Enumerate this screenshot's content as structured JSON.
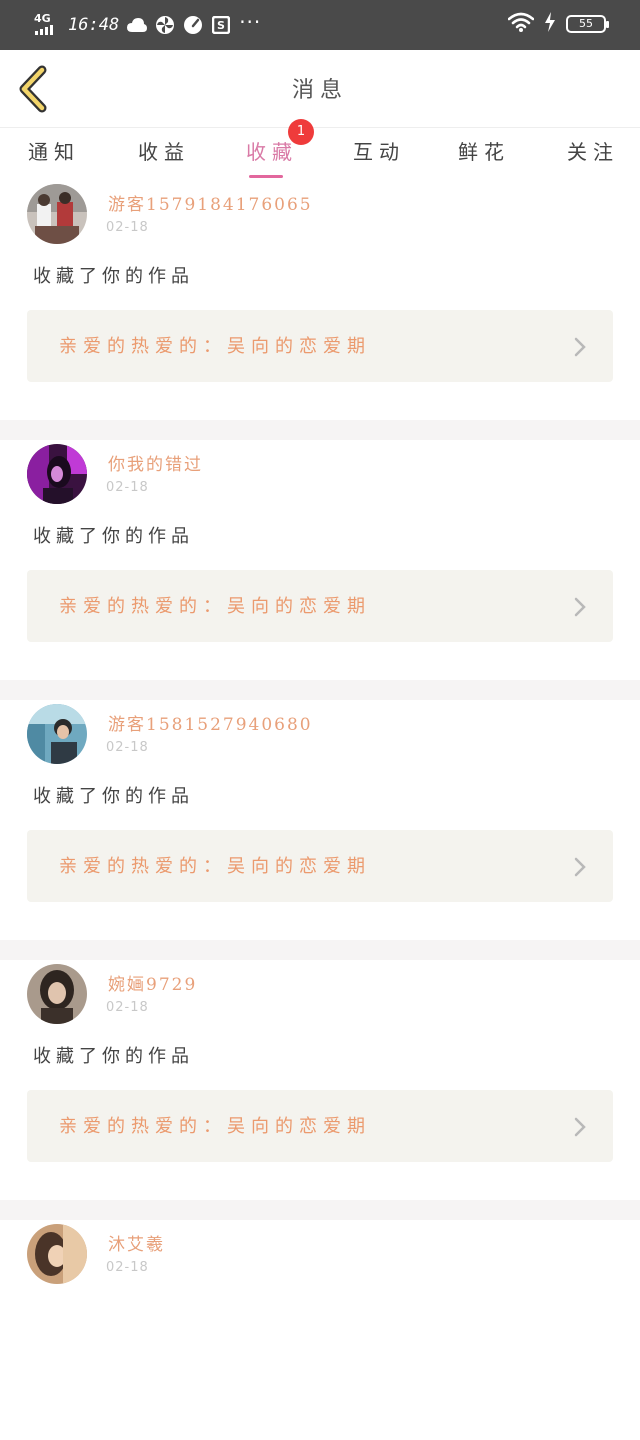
{
  "status_bar": {
    "network": "4G",
    "time": "16:48",
    "more": "···",
    "battery": "55"
  },
  "header": {
    "title": "消息",
    "back_icon": "chevron-left-icon"
  },
  "tabs": [
    {
      "label": "通知",
      "active": false
    },
    {
      "label": "收益",
      "active": false
    },
    {
      "label": "收藏",
      "active": true,
      "badge": "1"
    },
    {
      "label": "互动",
      "active": false
    },
    {
      "label": "鲜花",
      "active": false
    },
    {
      "label": "关注",
      "active": false
    }
  ],
  "messages": [
    {
      "user": "游客1579184176065",
      "date": "02-18",
      "action": "收藏了你的作品",
      "work": "亲爱的热爱的：吴向的恋爱期"
    },
    {
      "user": "你我的错过",
      "date": "02-18",
      "action": "收藏了你的作品",
      "work": "亲爱的热爱的：吴向的恋爱期"
    },
    {
      "user": "游客1581527940680",
      "date": "02-18",
      "action": "收藏了你的作品",
      "work": "亲爱的热爱的：吴向的恋爱期"
    },
    {
      "user": "婉婳9729",
      "date": "02-18",
      "action": "收藏了你的作品",
      "work": "亲爱的热爱的：吴向的恋爱期"
    },
    {
      "user": "沐艾羲",
      "date": "02-18"
    }
  ],
  "colors": {
    "accent": "#e2679d",
    "username": "#e8a07a",
    "work_title": "#eb9a6e",
    "badge": "#ef3b3b",
    "card_bg": "#f4f3ee"
  }
}
